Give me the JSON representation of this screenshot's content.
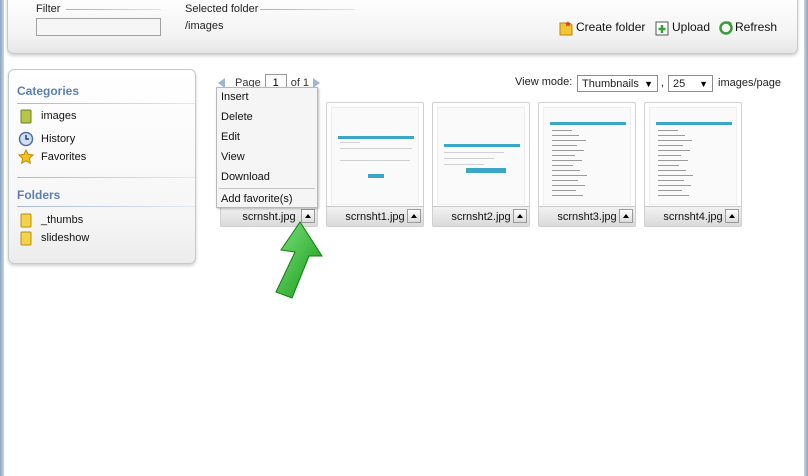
{
  "filter": {
    "label": "Filter",
    "value": ""
  },
  "selected_folder": {
    "label": "Selected folder",
    "path": "/images"
  },
  "toolbar": {
    "create_folder": "Create folder",
    "upload": "Upload",
    "refresh": "Refresh"
  },
  "sidebar": {
    "categories_title": "Categories",
    "categories": [
      {
        "label": "images",
        "icon": "folder-icon"
      },
      {
        "label": "History",
        "icon": "clock-icon"
      },
      {
        "label": "Favorites",
        "icon": "star-icon"
      }
    ],
    "folders_title": "Folders",
    "folders": [
      {
        "label": "_thumbs",
        "icon": "folder-icon"
      },
      {
        "label": "slideshow",
        "icon": "folder-icon"
      }
    ]
  },
  "pager": {
    "page_label": "Page",
    "page": "1",
    "of_label": "of 1"
  },
  "view": {
    "label": "View mode:",
    "mode": "Thumbnails",
    "comma": ",",
    "per_page": "25",
    "per_page_label": "images/page"
  },
  "thumbnails": [
    {
      "name": "scrnsht.jpg"
    },
    {
      "name": "scrnsht1.jpg"
    },
    {
      "name": "scrnsht2.jpg"
    },
    {
      "name": "scrnsht3.jpg"
    },
    {
      "name": "scrnsht4.jpg"
    }
  ],
  "context_menu": {
    "items": [
      "Insert",
      "Delete",
      "Edit",
      "View",
      "Download"
    ],
    "extra": "Add favorite(s)"
  },
  "colors": {
    "accent": "#5b7fb3",
    "arrow": "#2fb02f",
    "thumb_bar": "#3aa7c9"
  }
}
